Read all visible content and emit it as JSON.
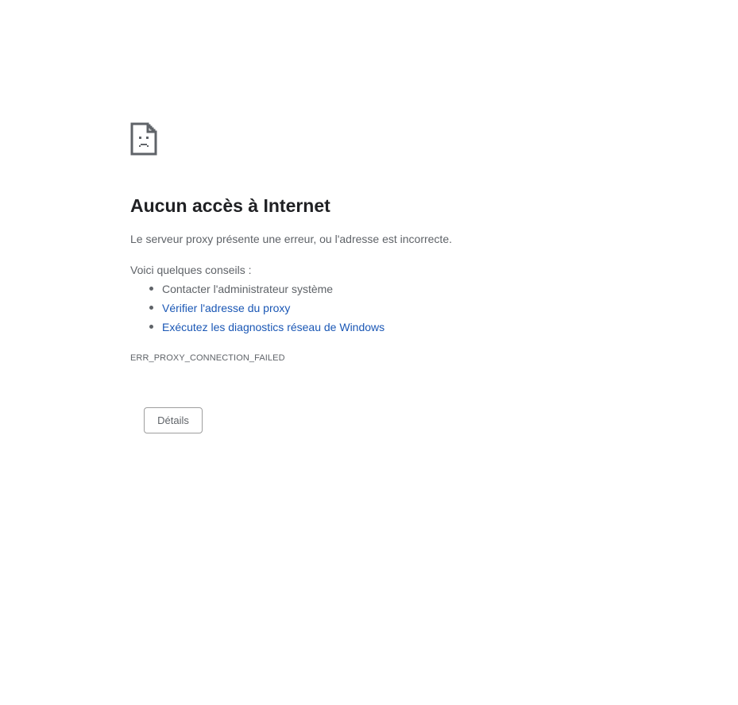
{
  "error_page": {
    "icon": "sad-document-icon",
    "title": "Aucun accès à Internet",
    "summary": "Le serveur proxy présente une erreur, ou l'adresse est incorrecte.",
    "tips_heading": "Voici quelques conseils :",
    "tips": [
      {
        "label": "Contacter l'administrateur système",
        "is_link": false
      },
      {
        "label": "Vérifier l'adresse du proxy",
        "is_link": true
      },
      {
        "label": "Exécutez les diagnostics réseau de Windows",
        "is_link": true
      }
    ],
    "error_code": "ERR_PROXY_CONNECTION_FAILED",
    "details_button_label": "Détails"
  },
  "colors": {
    "title": "#202124",
    "text": "#5f6368",
    "link": "#1a57b5",
    "background": "#ffffff"
  }
}
